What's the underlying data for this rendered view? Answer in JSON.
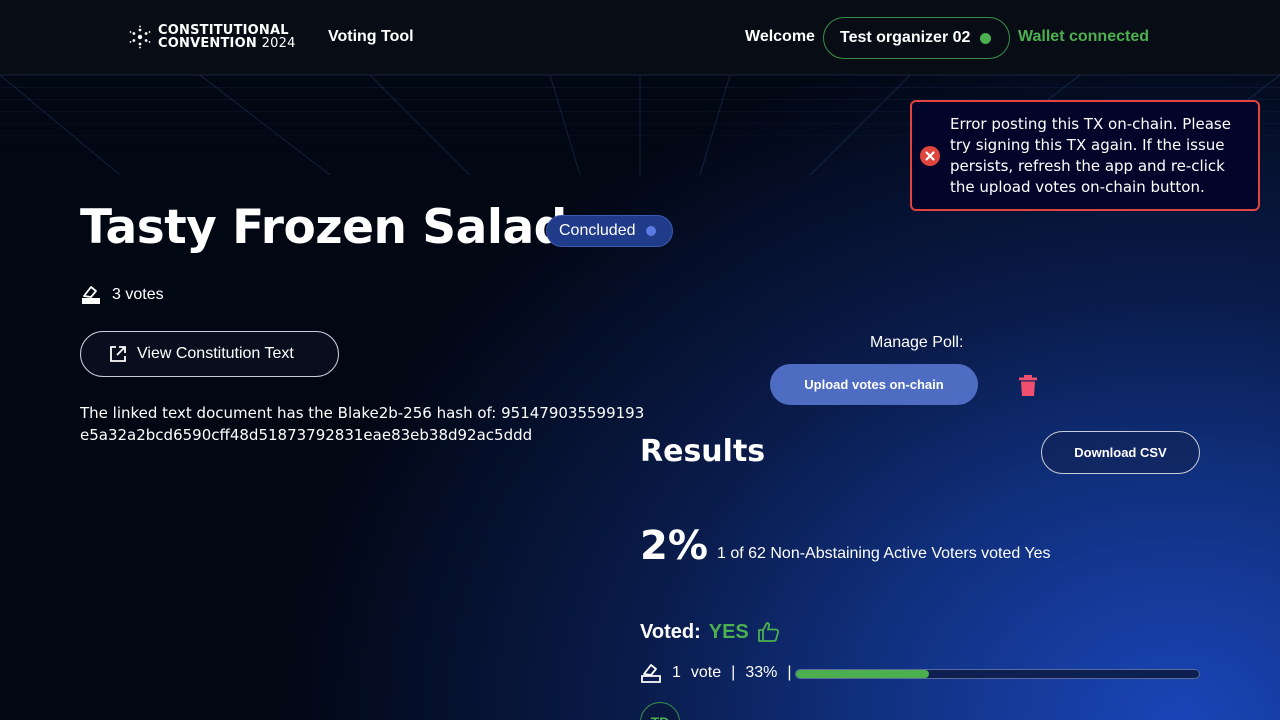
{
  "header": {
    "logo_line1": "CONSTITUTIONAL",
    "logo_line2": "CONVENTION",
    "logo_year": "2024",
    "nav_title": "Voting Tool",
    "welcome": "Welcome",
    "user_name": "Test organizer 02",
    "wallet_status": "Wallet connected"
  },
  "toast": {
    "message": "Error posting this TX on-chain. Please try signing this TX again. If the issue persists, refresh the app and re-click the upload votes on-chain button."
  },
  "poll": {
    "title": "Tasty Frozen Salad",
    "status": "Concluded",
    "votes_count": "3 votes",
    "view_button": "View Constitution Text",
    "hash_text": "The linked text document has the Blake2b-256 hash of: 951479035599193e5a32a2bcd6590cff48d51873792831eae83eb38d92ac5ddd"
  },
  "manage": {
    "label": "Manage Poll:",
    "upload_button": "Upload votes on-chain"
  },
  "results": {
    "heading": "Results",
    "download_button": "Download CSV",
    "percent": "2%",
    "description": "1 of 62 Non-Abstaining Active Voters voted Yes",
    "voted_label": "Voted:",
    "voted_value": "YES",
    "vote_count": "1",
    "vote_word": "vote",
    "separator": "|",
    "vote_percent": "33%",
    "progress": 0.33,
    "avatar_initials": "TD"
  },
  "colors": {
    "accent_green": "#4caf50",
    "error_red": "#e0443e",
    "primary_blue": "#4d6cc2"
  }
}
